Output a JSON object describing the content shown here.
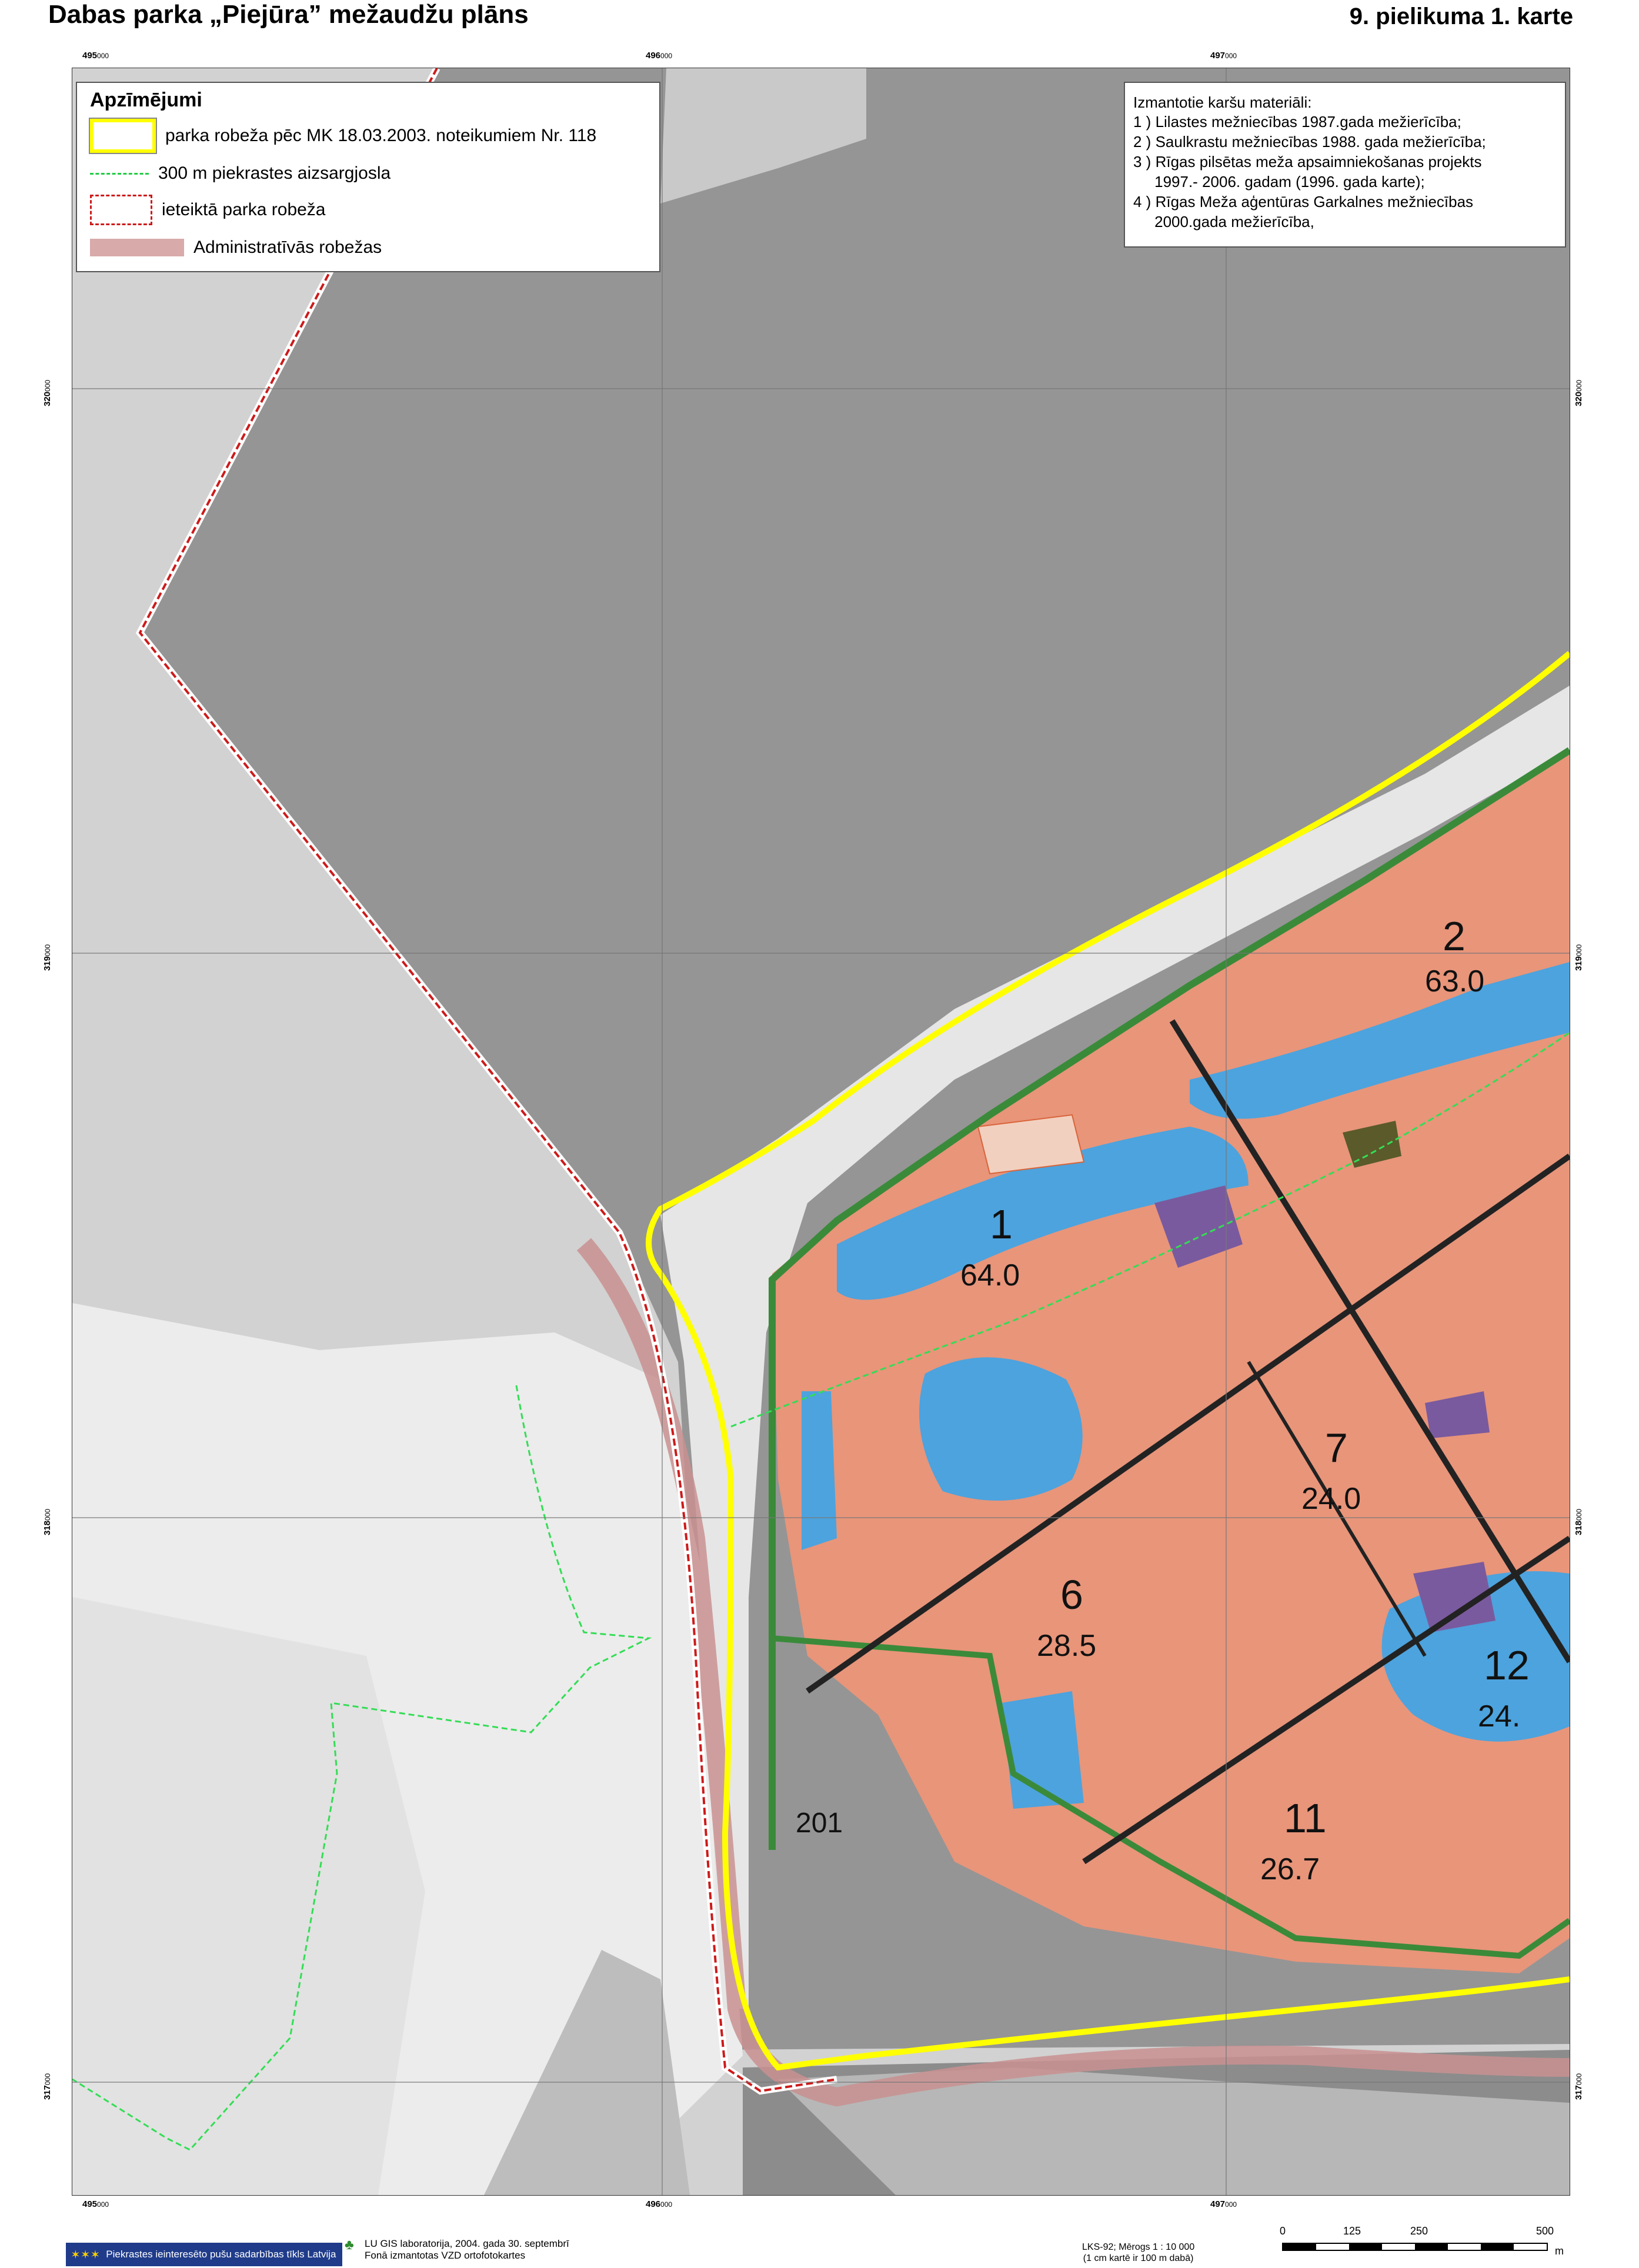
{
  "header": {
    "title": "Dabas parka „Piejūra” mežaudžu plāns",
    "annex": "9. pielikuma 1. karte"
  },
  "grid": {
    "x_labels": [
      {
        "km": "495",
        "m": "000"
      },
      {
        "km": "496",
        "m": "000"
      },
      {
        "km": "497",
        "m": "000"
      }
    ],
    "y_labels": [
      {
        "km": "320",
        "m": "000"
      },
      {
        "km": "319",
        "m": "000"
      },
      {
        "km": "318",
        "m": "000"
      },
      {
        "km": "317",
        "m": "000"
      }
    ]
  },
  "legend": {
    "title": "Apzīmējumi",
    "items": [
      {
        "label": "parka  robeža pēc MK 18.03.2003. noteikumiem Nr. 118",
        "color": "#ffff00"
      },
      {
        "label": "300 m piekrastes aizsargjosla",
        "color": "#22cc44"
      },
      {
        "label": "ieteiktā parka robeža",
        "color": "#cc1a1a"
      },
      {
        "label": "Administratīvās robežas",
        "color": "#d8aaaa"
      }
    ]
  },
  "sources": {
    "heading": "Izmantotie karšu materiāli:",
    "items": [
      "1 ) Lilastes mežniecības 1987.gada mežierīcība;",
      "2 ) Saulkrastu mežniecības 1988. gada mežierīcība;",
      "3 ) Rīgas pilsētas meža apsaimniekošanas projekts",
      "     1997.- 2006. gadam (1996. gada karte);",
      "4 ) Rīgas Meža aģentūras Garkalnes mežniecības",
      "     2000.gada mežierīcība,"
    ]
  },
  "map": {
    "colors": {
      "sea": "#959595",
      "land_light": "#d2d2d2",
      "photo_light": "#ececec",
      "photo_dark": "#8c8c8c",
      "forest_orange": "#e8957a",
      "water_blue": "#4da3dd",
      "purple": "#7a5a9e",
      "olive": "#5a5a2a",
      "green_border": "#3a8a3a",
      "yellow_boundary": "#ffff00",
      "admin_boundary": "#c99090"
    },
    "compartments": [
      {
        "id": "1",
        "area": "64.0"
      },
      {
        "id": "2",
        "area": "63.0"
      },
      {
        "id": "6",
        "area": "28.5"
      },
      {
        "id": "7",
        "area": "24.0"
      },
      {
        "id": "11",
        "area": "26.7"
      },
      {
        "id": "12",
        "area": "24."
      },
      {
        "id": "201",
        "area": ""
      }
    ]
  },
  "footer": {
    "logo_text": "Piekrastes ieinteresēto pušu sadarbības tīkls Latvija",
    "lab_line1": "LU GIS laboratorija, 2004. gada 30. septembrī",
    "lab_line2": "Fonā izmantotas VZD ortofotokartes",
    "scale_line1": "LKS-92; Mērogs 1 : 10 000",
    "scale_line2": "(1 cm kartē ir 100 m dabā)",
    "scale_ticks": [
      "0",
      "125",
      "250",
      "500"
    ],
    "scale_unit": "m"
  }
}
